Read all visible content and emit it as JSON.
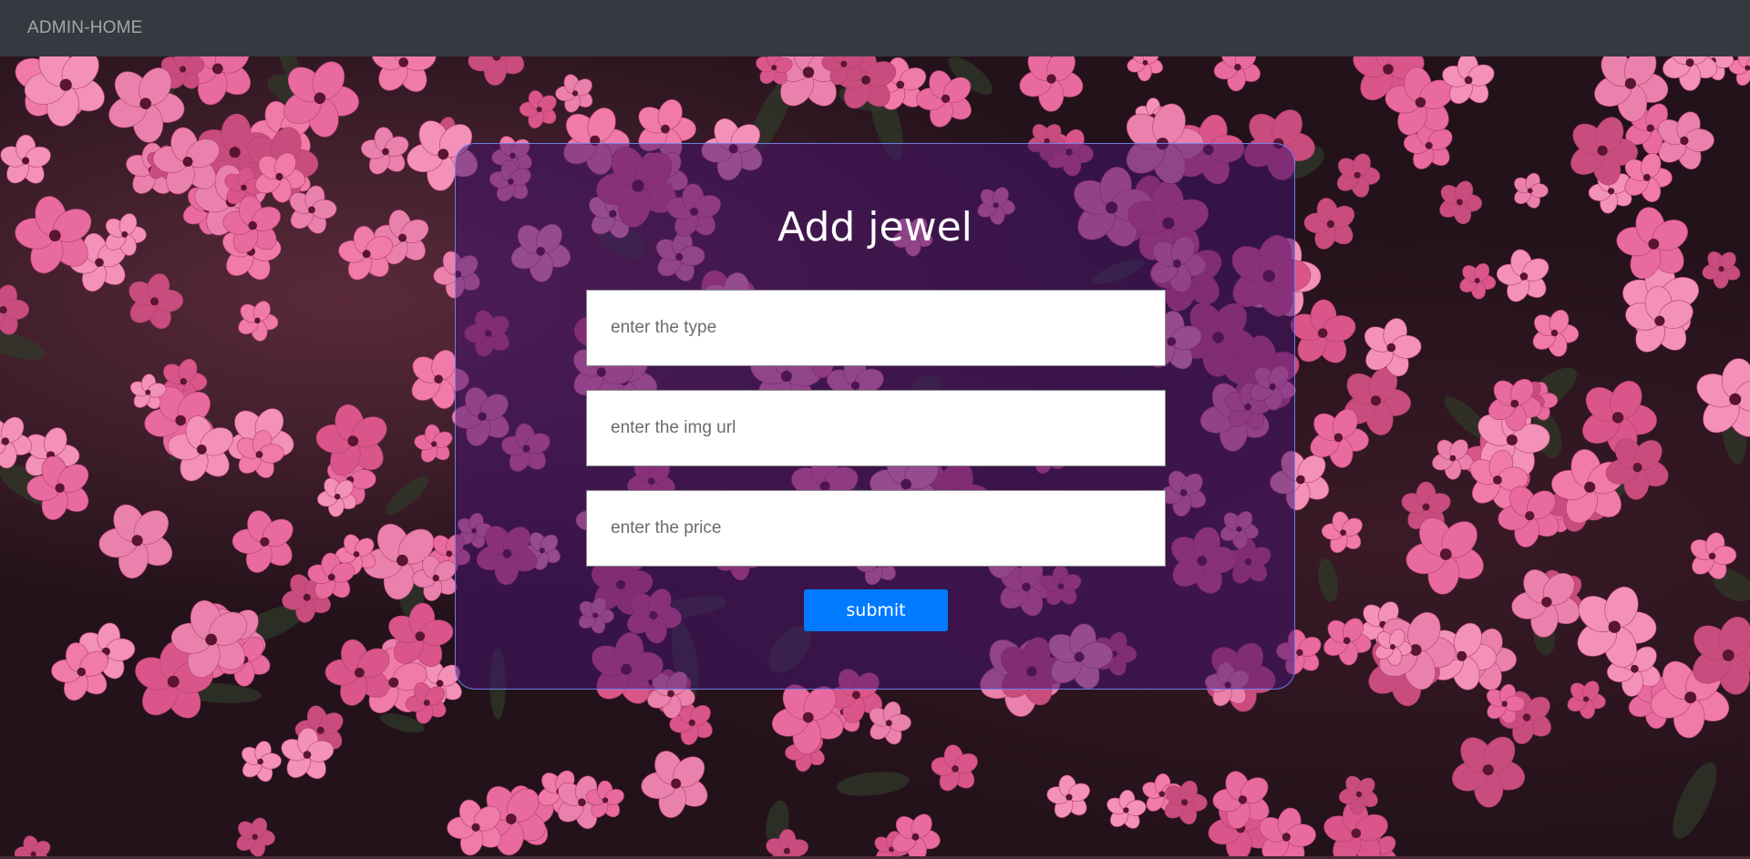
{
  "navbar": {
    "brand": "ADMIN-HOME"
  },
  "form": {
    "title": "Add jewel",
    "fields": {
      "type_placeholder": "enter the type",
      "img_placeholder": "enter the img url",
      "price_placeholder": "enter the price"
    },
    "submit_label": "submit"
  },
  "colors": {
    "navbar": "#343a40",
    "submit": "#007bff",
    "panel_border": "#788cff",
    "flower_pink": "#e86a9e"
  }
}
